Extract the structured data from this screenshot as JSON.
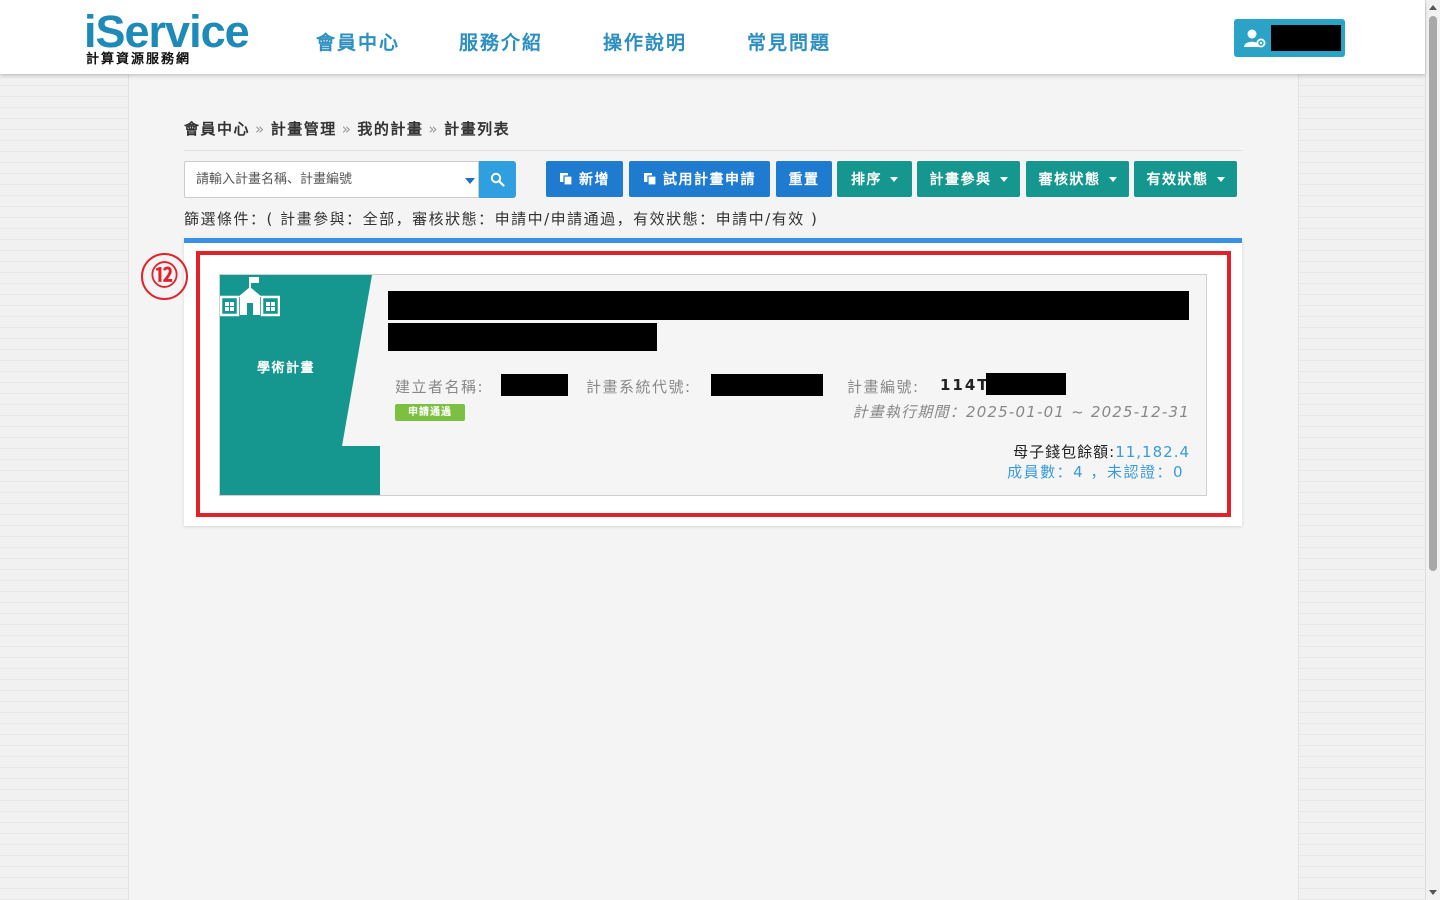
{
  "header": {
    "logo_main": "iService",
    "logo_sub": "計算資源服務網",
    "nav": [
      {
        "label": "會員中心"
      },
      {
        "label": "服務介紹"
      },
      {
        "label": "操作說明"
      },
      {
        "label": "常見問題"
      }
    ],
    "user_name": ""
  },
  "breadcrumb": [
    "會員中心",
    "計畫管理",
    "我的計畫",
    "計畫列表"
  ],
  "breadcrumb_sep": "»",
  "search": {
    "placeholder": "請輸入計畫名稱、計畫編號",
    "value": ""
  },
  "toolbar": {
    "add_label": "新增",
    "trial_label": "試用計畫申請",
    "reset_label": "重置",
    "sort_label": "排序",
    "participation_label": "計畫參與",
    "review_label": "審核狀態",
    "valid_label": "有效狀態"
  },
  "filter_text": "篩選條件：( 計畫參與：全部，審核狀態：申請中/申請通過，有效狀態：申請中/有效 )",
  "marker": "⑫",
  "colors": {
    "brand": "#1d8ab8",
    "teal": "#15978f",
    "blue_button": "#1f7bd0",
    "highlight": "#e0232a",
    "status_green": "#7cc042"
  },
  "project": {
    "type_label": "學術計畫",
    "type_icon": "school-icon",
    "creator_label": "建立者名稱:",
    "system_code_label": "計畫系統代號:",
    "number_label": "計畫編號:",
    "number_prefix": "114T",
    "status_badge": "申請通過",
    "period": "計畫執行期間：2025-01-01 ~ 2025-12-31",
    "wallet_label": "母子錢包餘額:",
    "wallet_value": "11,182.4",
    "members_text": "成員數：4 ，未認證：0"
  }
}
